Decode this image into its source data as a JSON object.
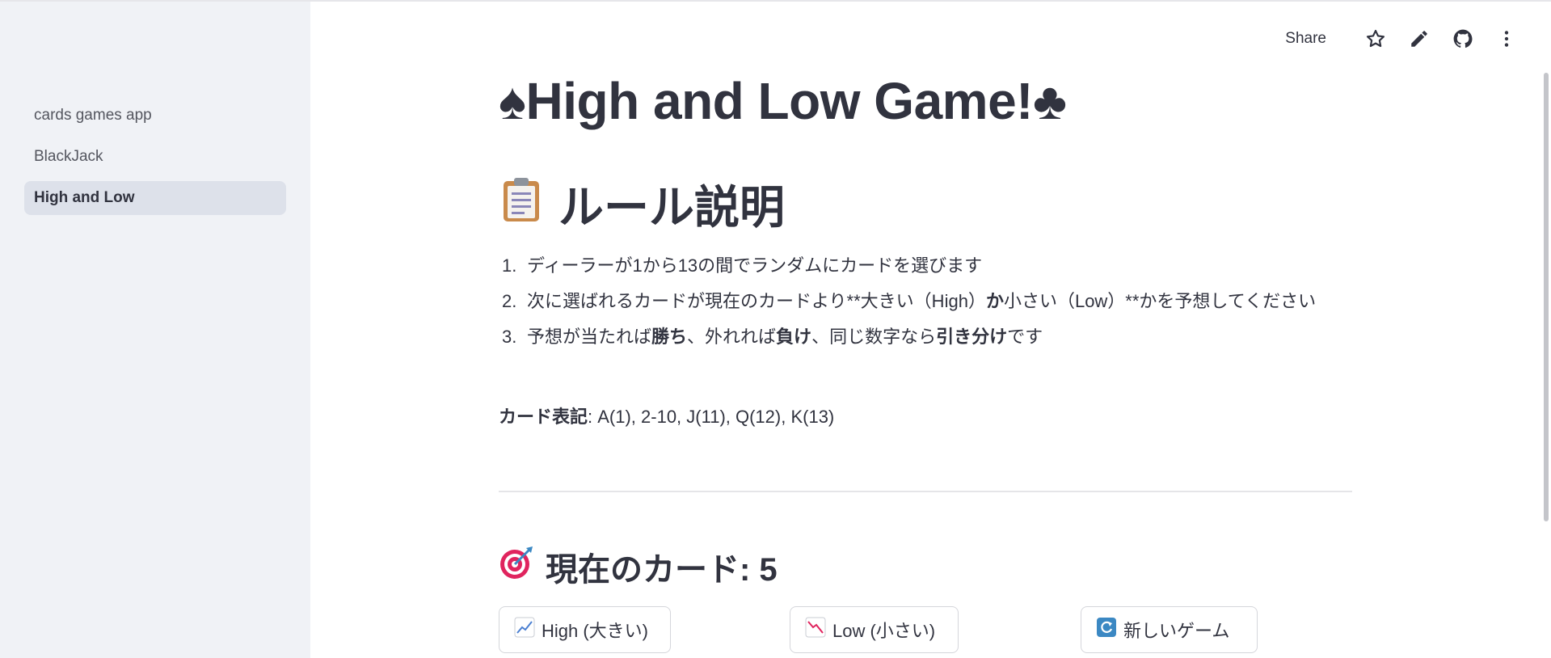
{
  "sidebar": {
    "items": [
      {
        "label": "cards games app"
      },
      {
        "label": "BlackJack"
      },
      {
        "label": "High and Low"
      }
    ]
  },
  "toolbar": {
    "share_label": "Share",
    "icons": [
      "star-icon",
      "pencil-icon",
      "github-icon",
      "more-vert-icon"
    ]
  },
  "main": {
    "title": "♠High and Low Game!♣",
    "rules_heading": "ルール説明",
    "rules": [
      {
        "num": "1.",
        "text": "ディーラーが1から13の間でランダムにカードを選びます"
      },
      {
        "num": "2.",
        "a": "次に選ばれるカードが現在のカードより**大きい（High）",
        "b": "か",
        "c": "小さい（Low）**かを予想してください"
      },
      {
        "num": "3.",
        "a": "予想が当たれば",
        "b": "勝ち",
        "c": "、外れれば",
        "d": "負け",
        "e": "、同じ数字なら",
        "f": "引き分け",
        "g": "です"
      }
    ],
    "notation_label": "カード表記",
    "notation_value": ": A(1), 2-10, J(11), Q(12), K(13)",
    "current_card_label": "現在のカード: 5",
    "buttons": {
      "high": "High (大きい)",
      "low": "Low (小さい)",
      "new_game": "新しいゲーム"
    }
  },
  "colors": {
    "sidebar_bg": "#f0f2f6",
    "active_item_bg": "#dde1ea",
    "text": "#31333f"
  }
}
